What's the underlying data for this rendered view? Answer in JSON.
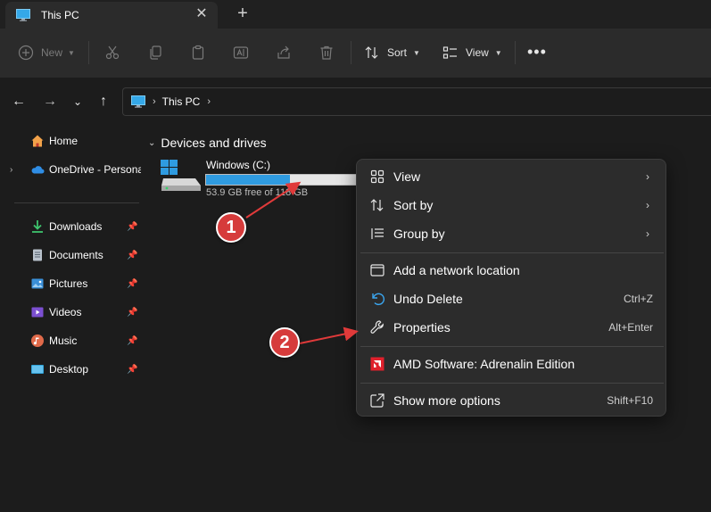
{
  "tab": {
    "title": "This PC",
    "close_symbol": "✕",
    "new_tab_symbol": "+"
  },
  "toolbar": {
    "new_label": "New",
    "sort_label": "Sort",
    "view_label": "View",
    "more_label": "•••"
  },
  "address": {
    "crumb": "This PC"
  },
  "sidebar": {
    "items": [
      {
        "label": "Home",
        "icon": "home-icon"
      },
      {
        "label": "OneDrive - Persona",
        "icon": "onedrive-cloud-icon"
      },
      {
        "label": "Downloads",
        "icon": "download-icon"
      },
      {
        "label": "Documents",
        "icon": "document-icon"
      },
      {
        "label": "Pictures",
        "icon": "pictures-icon"
      },
      {
        "label": "Videos",
        "icon": "video-icon"
      },
      {
        "label": "Music",
        "icon": "music-icon"
      },
      {
        "label": "Desktop",
        "icon": "desktop-icon"
      }
    ]
  },
  "main": {
    "section_title": "Devices and drives",
    "drive": {
      "name": "Windows (C:)",
      "free_text": "53.9 GB free of 118 GB",
      "used_fraction": 0.54
    }
  },
  "context_menu": {
    "items": [
      {
        "label": "View",
        "icon": "grid-icon",
        "submenu": true
      },
      {
        "label": "Sort by",
        "icon": "sort-icon",
        "submenu": true
      },
      {
        "label": "Group by",
        "icon": "group-list-icon",
        "submenu": true
      },
      {
        "label": "Add a network location",
        "icon": "window-icon"
      },
      {
        "label": "Undo Delete",
        "icon": "undo-icon",
        "shortcut": "Ctrl+Z"
      },
      {
        "label": "Properties",
        "icon": "wrench-icon",
        "shortcut": "Alt+Enter"
      },
      {
        "label": "AMD Software: Adrenalin Edition",
        "icon": "amd-logo-icon"
      },
      {
        "label": "Show more options",
        "icon": "open-external-icon",
        "shortcut": "Shift+F10"
      }
    ]
  },
  "callouts": {
    "first": "1",
    "second": "2"
  },
  "colors": {
    "accent": "#2f9be0",
    "callout": "#d63b3b",
    "amd_red": "#e0202c"
  }
}
